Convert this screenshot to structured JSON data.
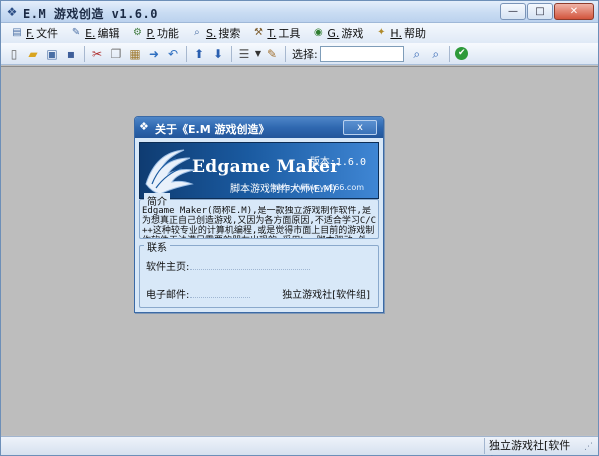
{
  "window": {
    "title": "E.M 游戏创造 v1.6.0",
    "buttons": {
      "minimize": "—",
      "maximize": "□",
      "close": "✕"
    }
  },
  "menu": [
    {
      "accel": "F.",
      "label": "文件",
      "icon": "file-icon"
    },
    {
      "accel": "E.",
      "label": "编辑",
      "icon": "edit-icon"
    },
    {
      "accel": "P.",
      "label": "功能",
      "icon": "function-icon"
    },
    {
      "accel": "S.",
      "label": "搜索",
      "icon": "search-icon"
    },
    {
      "accel": "T.",
      "label": "工具",
      "icon": "tools-icon"
    },
    {
      "accel": "G.",
      "label": "游戏",
      "icon": "game-icon"
    },
    {
      "accel": "H.",
      "label": "帮助",
      "icon": "help-icon"
    }
  ],
  "toolbar": {
    "search_label": "选择:",
    "search_value": "",
    "icons": [
      "new-file-icon",
      "open-folder-icon",
      "save-all-icon",
      "save-icon",
      "cut-icon",
      "copy-icon",
      "paste-icon",
      "redo-icon",
      "undo-icon",
      "navigate-up-icon",
      "navigate-down-icon",
      "list-icon",
      "dropdown-arrow-icon",
      "script-icon",
      "search-icon",
      "find-next-icon",
      "check-icon"
    ]
  },
  "dialog": {
    "title": "关于《E.M 游戏创造》",
    "close": "x",
    "banner": {
      "title": "Edgame Maker",
      "version": "版本:1.6.0",
      "subtitle": "脚本游戏制作大师(E.M)",
      "url": "http://www.yx166.com"
    },
    "intro": {
      "legend": "简介",
      "text": "    Edgame Maker(简称E.M),是一款独立游戏制作软件,是为想真正自己创造游戏,又因为各方面原因,不适合学习C/C++这种较专业的计算机编程,或是觉得市面上目前的游戏制作软件无法满足需要的朋友出现的.采用Lua脚本驱动,外"
    },
    "contact": {
      "legend": "联系",
      "homepage_label": "软件主页:",
      "email_label": "电子邮件:",
      "org": "独立游戏社[软件组]"
    }
  },
  "status": {
    "text": "独立游戏社[软件组]"
  },
  "colors": {
    "workspace": "#bdbdbd",
    "dialog_title": "#2f68b0",
    "banner": "#1a5aa0"
  }
}
